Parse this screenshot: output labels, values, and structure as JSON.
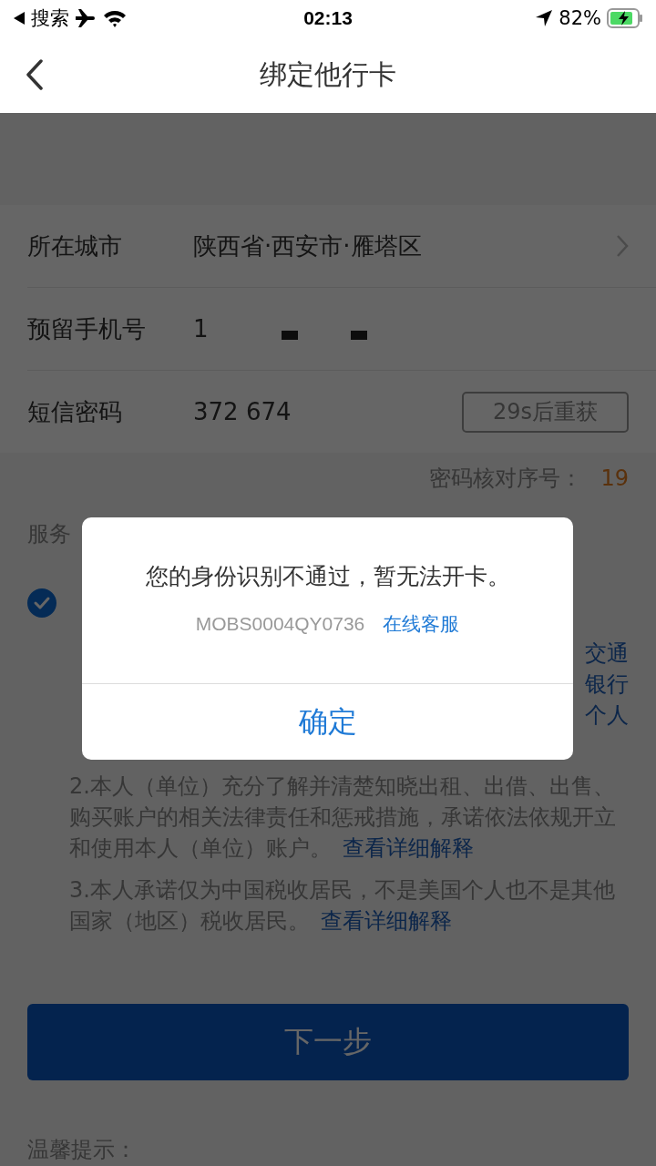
{
  "status_bar": {
    "back_app": "搜索",
    "time": "02:13",
    "battery": "82%"
  },
  "nav": {
    "title": "绑定他行卡"
  },
  "form": {
    "rows": [
      {
        "kind": "select",
        "label": "所在城市",
        "value": "陕西省·西安市·雁塔区"
      },
      {
        "kind": "phone",
        "label": "预留手机号",
        "value": "1"
      },
      {
        "kind": "code",
        "label": "短信密码",
        "value": "372 674",
        "button": "29s后重获",
        "disabled": true
      }
    ]
  },
  "serial": {
    "label": "密码核对序号：",
    "value": "19"
  },
  "agreement": {
    "heading": "服务",
    "checked": true,
    "fragments": [
      "交通",
      "银行",
      "个人"
    ],
    "paragraphs": [
      {
        "text": "2.本人（单位）充分了解并清楚知晓出租、出借、出售、购买账户的相关法律责任和惩戒措施，承诺依法依规开立和使用本人（单位）账户。",
        "link": "查看详细解释"
      },
      {
        "text": "3.本人承诺仅为中国税收居民，不是美国个人也不是其他国家（地区）税收居民。",
        "link": "查看详细解释"
      }
    ]
  },
  "next_button": "下一步",
  "tips_heading": "温馨提示：",
  "dialog": {
    "message": "您的身份识别不通过，暂无法开卡。",
    "code": "MOBS0004QY0736",
    "link": "在线客服",
    "button": "确定"
  }
}
